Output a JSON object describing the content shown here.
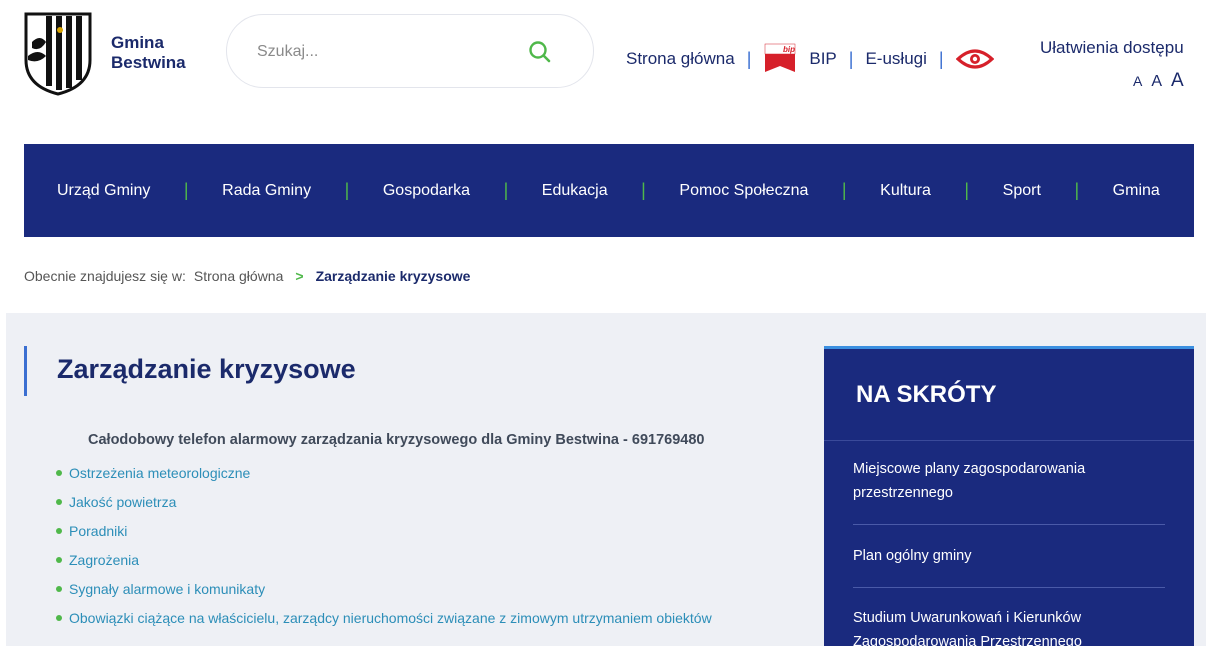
{
  "header": {
    "logo_line1": "Gmina",
    "logo_line2": "Bestwina",
    "search_placeholder": "Szukaj..."
  },
  "topnav": {
    "home": "Strona główna",
    "bip": "BIP",
    "eservices": "E-usługi",
    "accessibility": "Ułatwienia dostępu",
    "font_sizes": [
      "A",
      "A",
      "A"
    ]
  },
  "mainnav": [
    "Urząd Gminy",
    "Rada Gminy",
    "Gospodarka",
    "Edukacja",
    "Pomoc Społeczna",
    "Kultura",
    "Sport",
    "Gmina"
  ],
  "breadcrumb": {
    "prefix": "Obecnie znajdujesz się w:",
    "home": "Strona główna",
    "separator": ">",
    "current": "Zarządzanie kryzysowe"
  },
  "main": {
    "title": "Zarządzanie kryzysowe",
    "phone_line": "Całodobowy telefon alarmowy zarządzania kryzysowego dla Gminy Bestwina - 691769480",
    "links": [
      "Ostrzeżenia meteorologiczne",
      "Jakość powietrza",
      "Poradniki",
      "Zagrożenia",
      "Sygnały alarmowe i komunikaty",
      "Obowiązki ciążące na właścicielu, zarządcy nieruchomości związane z zimowym utrzymaniem obiektów"
    ]
  },
  "sidebar": {
    "title": "NA SKRÓTY",
    "items": [
      "Miejscowe plany zagospodarowania przestrzennego",
      "Plan ogólny gminy",
      "Studium Uwarunkowań i Kierunków Zagospodarowania Przestrzennego"
    ]
  },
  "colors": {
    "navy": "#1a2a7e",
    "accent_green": "#4fb84a",
    "link_blue": "#2c8eb8",
    "bip_red": "#d6202a"
  }
}
